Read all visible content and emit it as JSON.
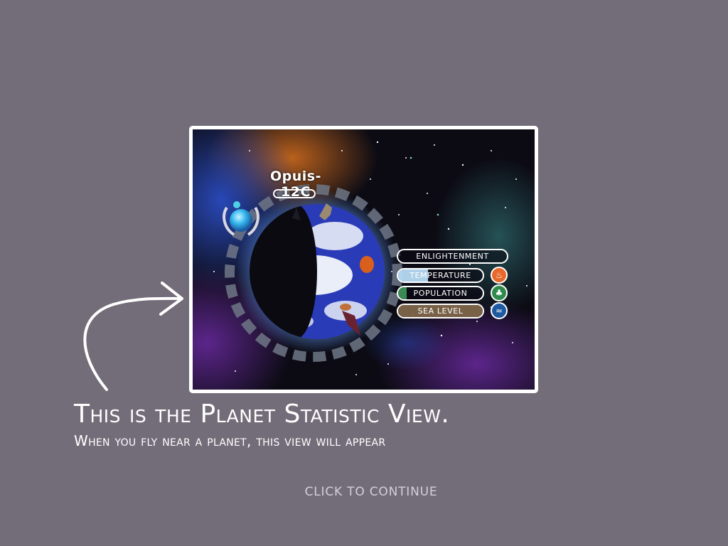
{
  "planet": {
    "name": "Opuis-12C",
    "stats": [
      {
        "id": "enlightenment",
        "label": "ENLIGHTENMENT",
        "level": 0.0,
        "fill_color": "#ffffff",
        "icon": ""
      },
      {
        "id": "temperature",
        "label": "TEMPERATURE",
        "level": 0.35,
        "fill_color": "#bfe6ff",
        "icon": "temperature-bird-icon",
        "icon_color": "#e8672a"
      },
      {
        "id": "population",
        "label": "POPULATION",
        "level": 0.1,
        "fill_color": "#3f9a5a",
        "icon": "population-bird-icon",
        "icon_color": "#2f8a4c"
      },
      {
        "id": "sea_level",
        "label": "SEA LEVEL",
        "level": 1.0,
        "fill_color": "#8c7150",
        "icon": "sea-level-bird-icon",
        "icon_color": "#1d5aa0"
      }
    ]
  },
  "tutorial": {
    "headline": "This is the Planet Statistic View.",
    "subline": "When you fly near a planet, this view will appear",
    "continue_label": "CLICK TO CONTINUE"
  },
  "colors": {
    "background": "#736d79",
    "frame_border": "#ffffff",
    "ocean": "#2a3bb8",
    "landmass": "#e9eef8"
  }
}
